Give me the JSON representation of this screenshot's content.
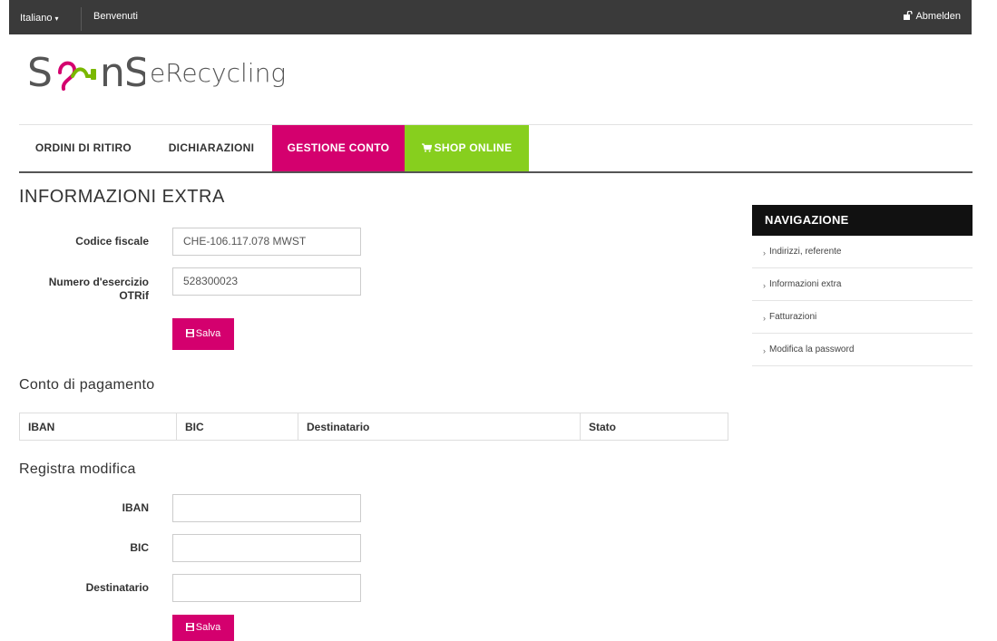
{
  "topbar": {
    "language": "Italiano",
    "welcome": "Benvenuti",
    "logout": "Abmelden"
  },
  "logo": {
    "brand": "SONS",
    "tagline": "eRecycling",
    "colors": {
      "text": "#555555",
      "plug_pink": "#d4006e",
      "plug_green": "#7ab800"
    }
  },
  "mainnav": {
    "items": [
      {
        "label": "ORDINI DI RITIRO"
      },
      {
        "label": "DICHIARAZIONI"
      },
      {
        "label": "GESTIONE CONTO",
        "active": true
      },
      {
        "label": "SHOP ONLINE",
        "icon": "cart-icon"
      }
    ],
    "colors": {
      "active": "#d4006e",
      "shop": "#87cf1e"
    }
  },
  "extra": {
    "title": "INFORMAZIONI EXTRA",
    "codice_label": "Codice fiscale",
    "codice_value": "CHE-106.117.078 MWST",
    "numero_label_1": "Numero d'esercizio",
    "numero_label_2": "OTRif",
    "numero_value": "528300023",
    "save_label": "Salva"
  },
  "payment": {
    "title": "Conto di pagamento",
    "columns": [
      "IBAN",
      "BIC",
      "Destinatario",
      "Stato"
    ]
  },
  "register": {
    "title": "Registra modifica",
    "iban_label": "IBAN",
    "bic_label": "BIC",
    "destinatario_label": "Destinatario",
    "iban_value": "",
    "bic_value": "",
    "destinatario_value": "",
    "save_label": "Salva"
  },
  "sidebar": {
    "title": "NAVIGAZIONE",
    "items": [
      {
        "label": "Indirizzi, referente"
      },
      {
        "label": "Informazioni extra"
      },
      {
        "label": "Fatturazioni"
      },
      {
        "label": "Modifica la password"
      }
    ]
  }
}
